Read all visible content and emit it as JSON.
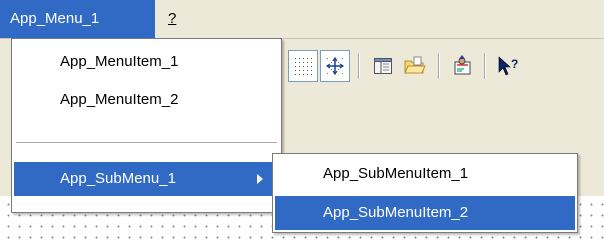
{
  "menubar": {
    "items": [
      {
        "label": "App_Menu_1"
      },
      {
        "label": "?"
      }
    ]
  },
  "popup_menu": {
    "items": [
      {
        "label": "App_MenuItem_1"
      },
      {
        "label": "App_MenuItem_2"
      },
      {
        "label": "App_SubMenu_1"
      }
    ]
  },
  "submenu": {
    "items": [
      {
        "label": "App_SubMenuItem_1"
      },
      {
        "label": "App_SubMenuItem_2"
      }
    ]
  },
  "toolbar": {
    "buttons": [
      {
        "icon": "grid-dots-icon",
        "pressed": true
      },
      {
        "icon": "snap-to-grid-icon",
        "pressed": true
      },
      {
        "icon": "properties-panel-icon",
        "pressed": false
      },
      {
        "icon": "folder-open-icon",
        "pressed": false
      },
      {
        "icon": "wizard-icon",
        "pressed": false
      },
      {
        "icon": "context-help-icon",
        "pressed": false
      }
    ]
  },
  "colors": {
    "menu_background": "#ece9d8",
    "highlight": "#316ac5",
    "highlight_text": "#ffffff",
    "popup_background": "#ffffff"
  }
}
